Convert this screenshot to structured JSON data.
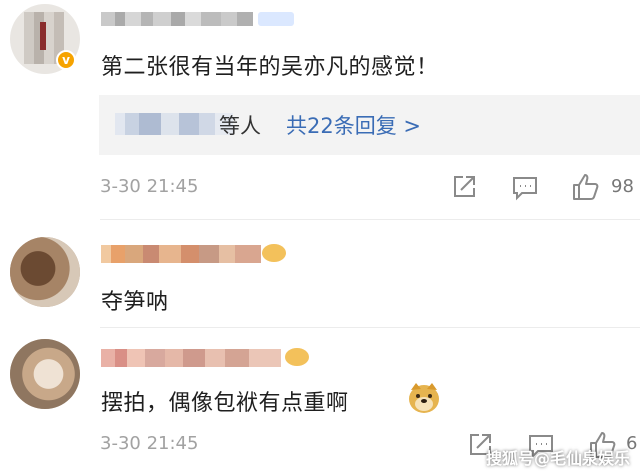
{
  "comments": [
    {
      "text": "第二张很有当年的吴亦凡的感觉！",
      "reply_summary": {
        "suffix": "等人",
        "link": "共22条回复 >"
      },
      "time": "3-30 21:45",
      "like_count": "98",
      "verified_badge": "v"
    },
    {
      "text": "夺笋呐"
    },
    {
      "text": "摆拍，偶像包袱有点重啊",
      "emoji_icon": "doge-emoji-icon",
      "time": "3-30 21:45",
      "like_count": "6"
    }
  ],
  "watermark": "搜狐号@毛仙泉娱乐",
  "icons": {
    "share": "share-icon",
    "comment": "comment-icon",
    "like": "thumbs-up-icon"
  },
  "colors": {
    "link": "#3a6cb5",
    "time": "#a2a2a2",
    "reply_bg": "#f3f3f3"
  }
}
